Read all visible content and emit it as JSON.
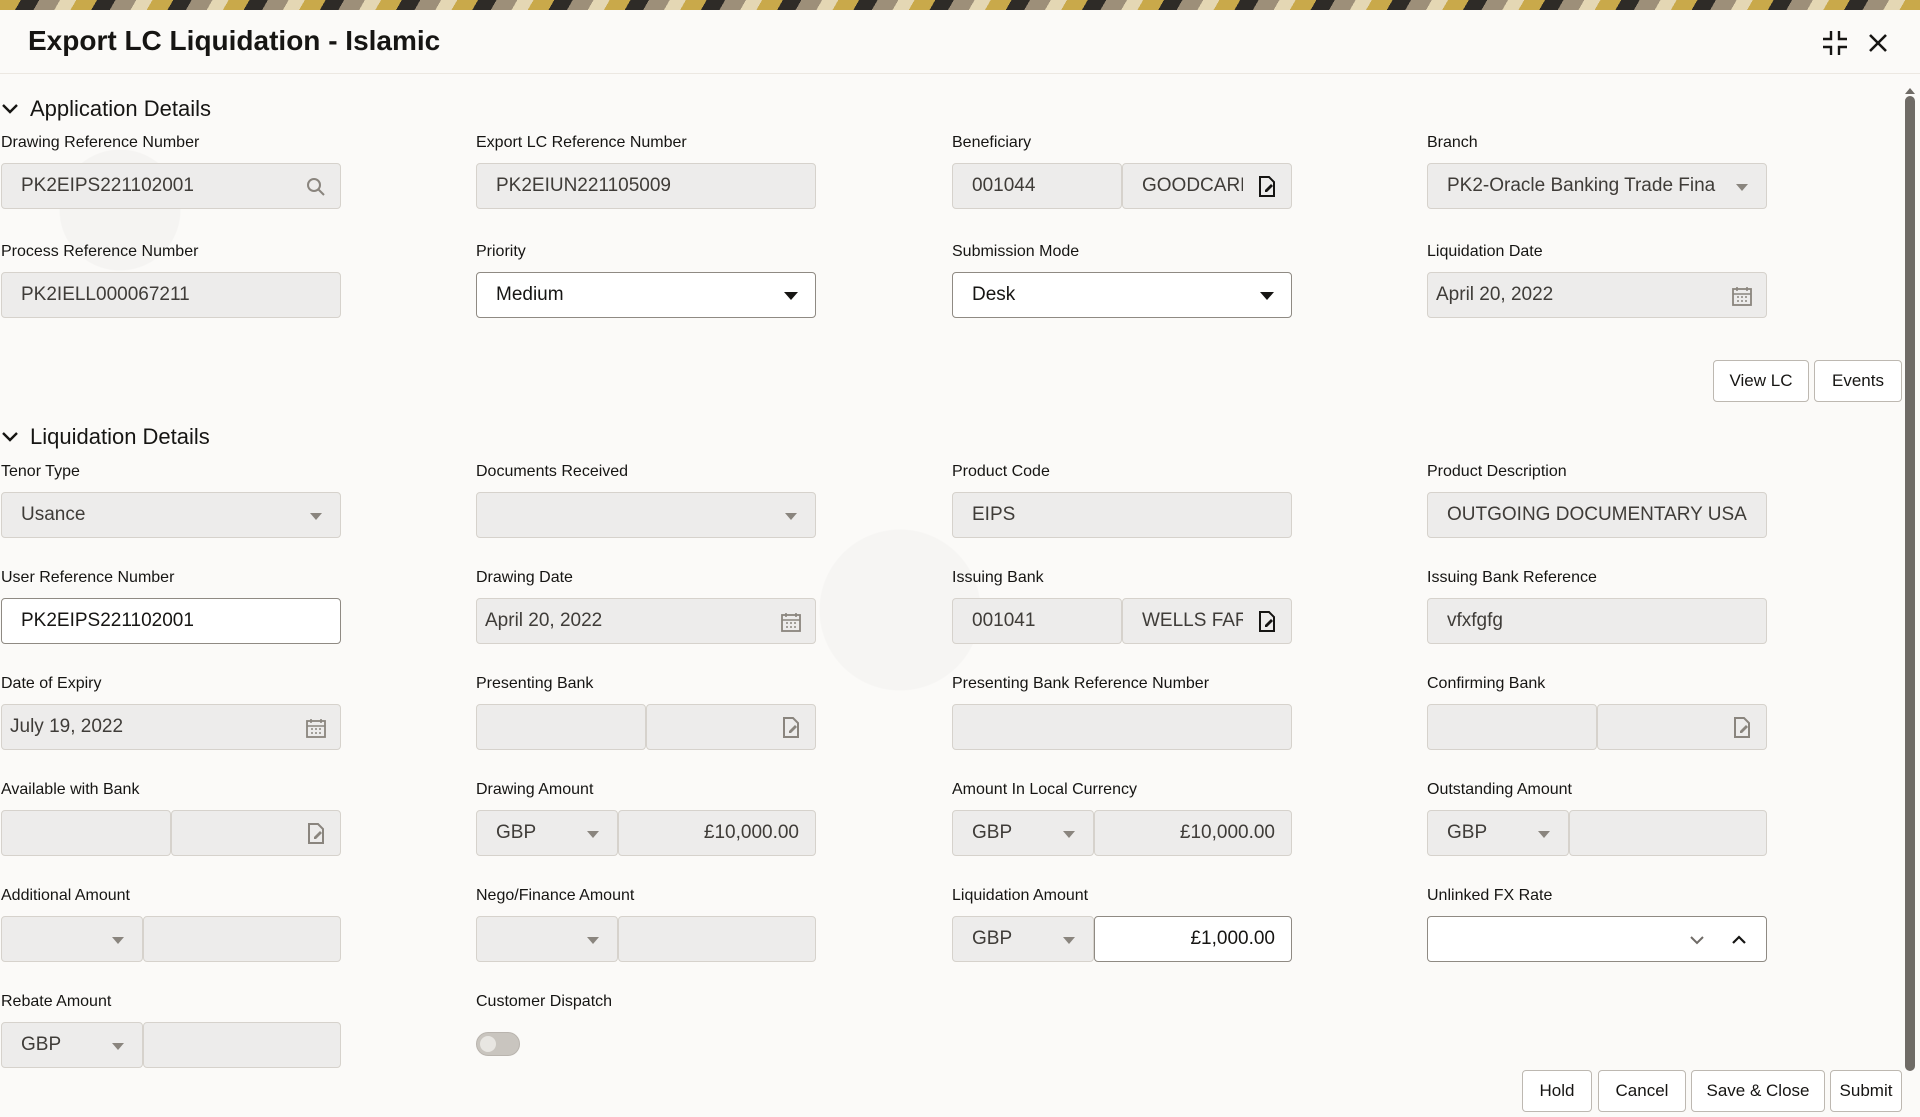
{
  "window": {
    "title": "Export LC Liquidation - Islamic"
  },
  "sections": {
    "application": "Application Details",
    "liquidation": "Liquidation Details"
  },
  "application": {
    "drawing_ref": {
      "label": "Drawing Reference Number",
      "value": "PK2EIPS221102001"
    },
    "export_lc_ref": {
      "label": "Export LC Reference Number",
      "value": "PK2EIUN221105009"
    },
    "beneficiary": {
      "label": "Beneficiary",
      "id": "001044",
      "name": "GOODCARE"
    },
    "branch": {
      "label": "Branch",
      "value": "PK2-Oracle Banking Trade Fina"
    },
    "process_ref": {
      "label": "Process Reference Number",
      "value": "PK2IELL000067211"
    },
    "priority": {
      "label": "Priority",
      "value": "Medium"
    },
    "submission_mode": {
      "label": "Submission Mode",
      "value": "Desk"
    },
    "liquidation_date": {
      "label": "Liquidation Date",
      "value": "April 20, 2022"
    }
  },
  "actions": {
    "view_lc": "View LC",
    "events": "Events"
  },
  "liquidation": {
    "tenor_type": {
      "label": "Tenor Type",
      "value": "Usance"
    },
    "documents_received": {
      "label": "Documents Received",
      "value": ""
    },
    "product_code": {
      "label": "Product Code",
      "value": "EIPS"
    },
    "product_description": {
      "label": "Product Description",
      "value": "OUTGOING DOCUMENTARY USANCE"
    },
    "user_ref": {
      "label": "User Reference Number",
      "value": "PK2EIPS221102001"
    },
    "drawing_date": {
      "label": "Drawing Date",
      "value": "April 20, 2022"
    },
    "issuing_bank": {
      "label": "Issuing Bank",
      "id": "001041",
      "name": "WELLS FAR"
    },
    "issuing_bank_ref": {
      "label": "Issuing Bank Reference",
      "value": "vfxfgfg"
    },
    "date_of_expiry": {
      "label": "Date of Expiry",
      "value": "July 19, 2022"
    },
    "presenting_bank": {
      "label": "Presenting Bank",
      "id": "",
      "name": ""
    },
    "presenting_bank_ref": {
      "label": "Presenting Bank Reference Number",
      "value": ""
    },
    "confirming_bank": {
      "label": "Confirming Bank",
      "id": "",
      "name": ""
    },
    "available_with_bank": {
      "label": "Available with Bank",
      "id": "",
      "name": ""
    },
    "drawing_amount": {
      "label": "Drawing Amount",
      "currency": "GBP",
      "value": "£10,000.00"
    },
    "amount_local": {
      "label": "Amount In Local Currency",
      "currency": "GBP",
      "value": "£10,000.00"
    },
    "outstanding_amount": {
      "label": "Outstanding Amount",
      "currency": "GBP",
      "value": ""
    },
    "additional_amount": {
      "label": "Additional Amount",
      "currency": "",
      "value": ""
    },
    "nego_finance_amount": {
      "label": "Nego/Finance Amount",
      "currency": "",
      "value": ""
    },
    "liquidation_amount": {
      "label": "Liquidation Amount",
      "currency": "GBP",
      "value": "£1,000.00"
    },
    "unlinked_fx_rate": {
      "label": "Unlinked FX Rate",
      "value": ""
    },
    "rebate_amount": {
      "label": "Rebate Amount",
      "currency": "GBP",
      "value": ""
    },
    "customer_dispatch": {
      "label": "Customer Dispatch",
      "enabled": false
    }
  },
  "footer": {
    "hold": "Hold",
    "cancel": "Cancel",
    "save_close": "Save & Close",
    "submit": "Submit"
  },
  "colors": {
    "field_bg": "#edeceb",
    "active_bg": "#ffffff",
    "text": "#161513"
  }
}
